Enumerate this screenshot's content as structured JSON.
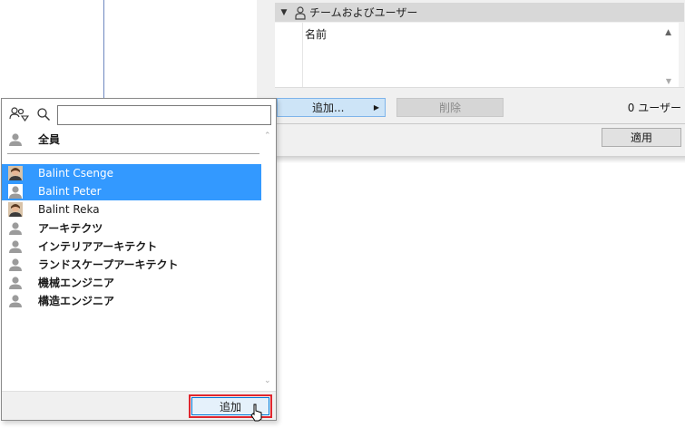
{
  "dialog": {
    "section_title": "チームおよびユーザー",
    "column_name": "名前",
    "add_dropdown_label": "追加...",
    "delete_label": "削除",
    "user_count": "0 ユーザー",
    "apply_label": "適用"
  },
  "popup": {
    "search_value": "",
    "all_label": "全員",
    "users": [
      {
        "label": "Balint Csenge",
        "selected": true,
        "bold": false,
        "avatar": "photo-avatar-icon"
      },
      {
        "label": "Balint Peter",
        "selected": true,
        "bold": false,
        "avatar": "person-placeholder-icon"
      },
      {
        "label": "Balint Reka",
        "selected": false,
        "bold": false,
        "avatar": "photo-avatar-icon"
      },
      {
        "label": "アーキテクツ",
        "selected": false,
        "bold": true,
        "avatar": "team-icon"
      },
      {
        "label": "インテリアアーキテクト",
        "selected": false,
        "bold": true,
        "avatar": "team-icon"
      },
      {
        "label": "ランドスケープアーキテクト",
        "selected": false,
        "bold": true,
        "avatar": "team-icon"
      },
      {
        "label": "機械エンジニア",
        "selected": false,
        "bold": true,
        "avatar": "team-icon"
      },
      {
        "label": "構造エンジニア",
        "selected": false,
        "bold": true,
        "avatar": "team-icon"
      }
    ],
    "add_label": "追加"
  },
  "colors": {
    "selection": "#3399ff",
    "highlight_border": "#e0262e",
    "dialog_bg": "#f0f0f0"
  }
}
